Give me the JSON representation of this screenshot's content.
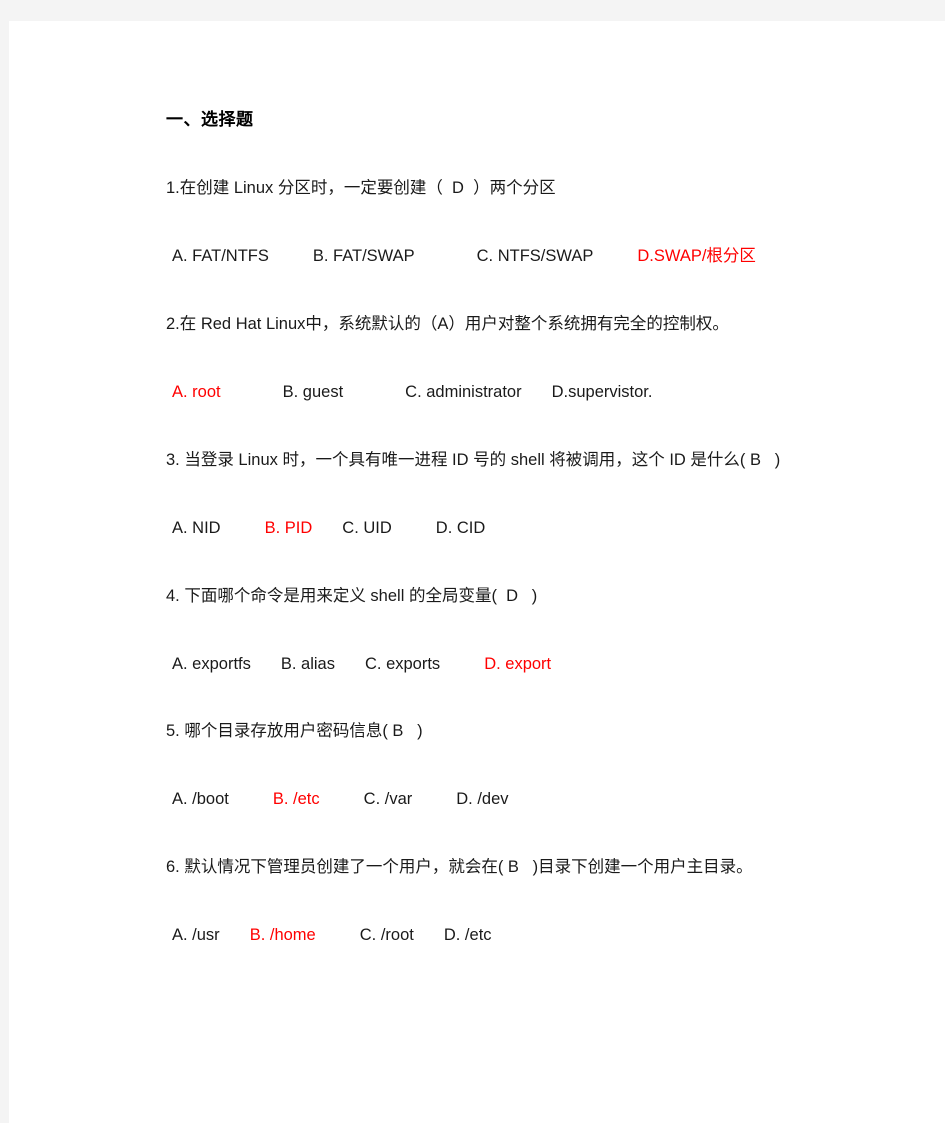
{
  "document": {
    "heading": "一、选择题",
    "page_background": "#f4f4f4",
    "sheet_background": "#ffffff",
    "answer_color": "#ff0000",
    "text_color": "#1a1a1a"
  },
  "questions": [
    {
      "id": "q1",
      "text": "1.在创建 Linux 分区时，一定要创建（  D  ）两个分区",
      "answer_letter": "D",
      "options": [
        {
          "label": "A. FAT/NTFS",
          "is_answer": false,
          "gap": "gap-md"
        },
        {
          "label": "B. FAT/SWAP",
          "is_answer": false,
          "gap": "gap-lg"
        },
        {
          "label": "C. NTFS/SWAP",
          "is_answer": false,
          "gap": "gap-md"
        },
        {
          "label": "D.SWAP/根分区",
          "is_answer": true,
          "gap": ""
        }
      ]
    },
    {
      "id": "q2",
      "text": "2.在 Red Hat Linux中，系统默认的（A）用户对整个系统拥有完全的控制权。",
      "answer_letter": "A",
      "options": [
        {
          "label": "A. root",
          "is_answer": true,
          "gap": "gap-lg"
        },
        {
          "label": "B. guest",
          "is_answer": false,
          "gap": "gap-lg"
        },
        {
          "label": "C. administrator",
          "is_answer": false,
          "gap": "gap-sm"
        },
        {
          "label": "D.supervistor.",
          "is_answer": false,
          "gap": ""
        }
      ]
    },
    {
      "id": "q3",
      "text": "3. 当登录 Linux 时，一个具有唯一进程 ID 号的 shell 将被调用，这个 ID 是什么( B   )",
      "answer_letter": "B",
      "options": [
        {
          "label": "A. NID",
          "is_answer": false,
          "gap": "gap-md"
        },
        {
          "label": "B. PID",
          "is_answer": true,
          "gap": "gap-sm"
        },
        {
          "label": "C. UID",
          "is_answer": false,
          "gap": "gap-md"
        },
        {
          "label": "D. CID",
          "is_answer": false,
          "gap": ""
        }
      ]
    },
    {
      "id": "q4",
      "text": "4. 下面哪个命令是用来定义 shell 的全局变量(  D   )",
      "answer_letter": "D",
      "options": [
        {
          "label": "A. exportfs",
          "is_answer": false,
          "gap": "gap-sm"
        },
        {
          "label": "B. alias",
          "is_answer": false,
          "gap": "gap-sm"
        },
        {
          "label": "C. exports",
          "is_answer": false,
          "gap": "gap-md"
        },
        {
          "label": "D. export",
          "is_answer": true,
          "gap": ""
        }
      ]
    },
    {
      "id": "q5",
      "text": "5. 哪个目录存放用户密码信息( B   )",
      "answer_letter": "B",
      "options": [
        {
          "label": "A. /boot",
          "is_answer": false,
          "gap": "gap-md"
        },
        {
          "label": "B. /etc",
          "is_answer": true,
          "gap": "gap-md"
        },
        {
          "label": "C. /var",
          "is_answer": false,
          "gap": "gap-md"
        },
        {
          "label": "D. /dev",
          "is_answer": false,
          "gap": ""
        }
      ]
    },
    {
      "id": "q6",
      "text": "6. 默认情况下管理员创建了一个用户，就会在( B   )目录下创建一个用户主目录。",
      "answer_letter": "B",
      "options": [
        {
          "label": "A. /usr",
          "is_answer": false,
          "gap": "gap-sm"
        },
        {
          "label": "B. /home",
          "is_answer": true,
          "gap": "gap-md"
        },
        {
          "label": "C. /root",
          "is_answer": false,
          "gap": "gap-sm"
        },
        {
          "label": "D. /etc",
          "is_answer": false,
          "gap": ""
        }
      ]
    }
  ]
}
